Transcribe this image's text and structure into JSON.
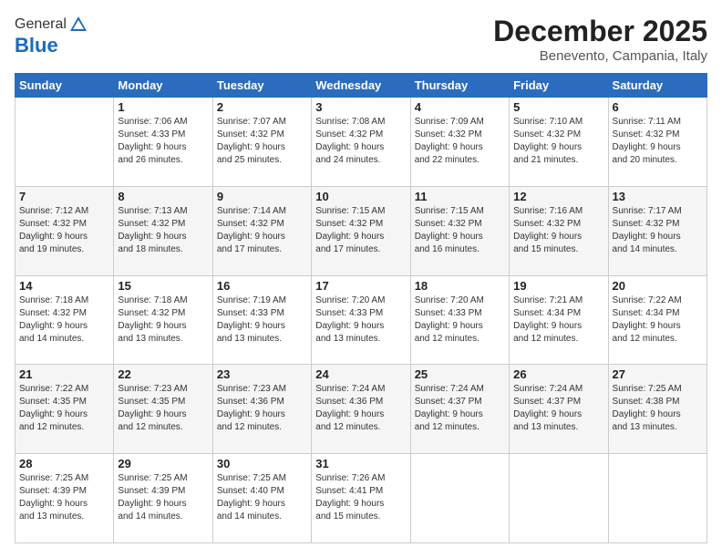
{
  "logo": {
    "general": "General",
    "blue": "Blue"
  },
  "header": {
    "month": "December 2025",
    "location": "Benevento, Campania, Italy"
  },
  "days_of_week": [
    "Sunday",
    "Monday",
    "Tuesday",
    "Wednesday",
    "Thursday",
    "Friday",
    "Saturday"
  ],
  "weeks": [
    [
      {
        "day": "",
        "info": ""
      },
      {
        "day": "1",
        "info": "Sunrise: 7:06 AM\nSunset: 4:33 PM\nDaylight: 9 hours\nand 26 minutes."
      },
      {
        "day": "2",
        "info": "Sunrise: 7:07 AM\nSunset: 4:32 PM\nDaylight: 9 hours\nand 25 minutes."
      },
      {
        "day": "3",
        "info": "Sunrise: 7:08 AM\nSunset: 4:32 PM\nDaylight: 9 hours\nand 24 minutes."
      },
      {
        "day": "4",
        "info": "Sunrise: 7:09 AM\nSunset: 4:32 PM\nDaylight: 9 hours\nand 22 minutes."
      },
      {
        "day": "5",
        "info": "Sunrise: 7:10 AM\nSunset: 4:32 PM\nDaylight: 9 hours\nand 21 minutes."
      },
      {
        "day": "6",
        "info": "Sunrise: 7:11 AM\nSunset: 4:32 PM\nDaylight: 9 hours\nand 20 minutes."
      }
    ],
    [
      {
        "day": "7",
        "info": "Sunrise: 7:12 AM\nSunset: 4:32 PM\nDaylight: 9 hours\nand 19 minutes."
      },
      {
        "day": "8",
        "info": "Sunrise: 7:13 AM\nSunset: 4:32 PM\nDaylight: 9 hours\nand 18 minutes."
      },
      {
        "day": "9",
        "info": "Sunrise: 7:14 AM\nSunset: 4:32 PM\nDaylight: 9 hours\nand 17 minutes."
      },
      {
        "day": "10",
        "info": "Sunrise: 7:15 AM\nSunset: 4:32 PM\nDaylight: 9 hours\nand 17 minutes."
      },
      {
        "day": "11",
        "info": "Sunrise: 7:15 AM\nSunset: 4:32 PM\nDaylight: 9 hours\nand 16 minutes."
      },
      {
        "day": "12",
        "info": "Sunrise: 7:16 AM\nSunset: 4:32 PM\nDaylight: 9 hours\nand 15 minutes."
      },
      {
        "day": "13",
        "info": "Sunrise: 7:17 AM\nSunset: 4:32 PM\nDaylight: 9 hours\nand 14 minutes."
      }
    ],
    [
      {
        "day": "14",
        "info": "Sunrise: 7:18 AM\nSunset: 4:32 PM\nDaylight: 9 hours\nand 14 minutes."
      },
      {
        "day": "15",
        "info": "Sunrise: 7:18 AM\nSunset: 4:32 PM\nDaylight: 9 hours\nand 13 minutes."
      },
      {
        "day": "16",
        "info": "Sunrise: 7:19 AM\nSunset: 4:33 PM\nDaylight: 9 hours\nand 13 minutes."
      },
      {
        "day": "17",
        "info": "Sunrise: 7:20 AM\nSunset: 4:33 PM\nDaylight: 9 hours\nand 13 minutes."
      },
      {
        "day": "18",
        "info": "Sunrise: 7:20 AM\nSunset: 4:33 PM\nDaylight: 9 hours\nand 12 minutes."
      },
      {
        "day": "19",
        "info": "Sunrise: 7:21 AM\nSunset: 4:34 PM\nDaylight: 9 hours\nand 12 minutes."
      },
      {
        "day": "20",
        "info": "Sunrise: 7:22 AM\nSunset: 4:34 PM\nDaylight: 9 hours\nand 12 minutes."
      }
    ],
    [
      {
        "day": "21",
        "info": "Sunrise: 7:22 AM\nSunset: 4:35 PM\nDaylight: 9 hours\nand 12 minutes."
      },
      {
        "day": "22",
        "info": "Sunrise: 7:23 AM\nSunset: 4:35 PM\nDaylight: 9 hours\nand 12 minutes."
      },
      {
        "day": "23",
        "info": "Sunrise: 7:23 AM\nSunset: 4:36 PM\nDaylight: 9 hours\nand 12 minutes."
      },
      {
        "day": "24",
        "info": "Sunrise: 7:24 AM\nSunset: 4:36 PM\nDaylight: 9 hours\nand 12 minutes."
      },
      {
        "day": "25",
        "info": "Sunrise: 7:24 AM\nSunset: 4:37 PM\nDaylight: 9 hours\nand 12 minutes."
      },
      {
        "day": "26",
        "info": "Sunrise: 7:24 AM\nSunset: 4:37 PM\nDaylight: 9 hours\nand 13 minutes."
      },
      {
        "day": "27",
        "info": "Sunrise: 7:25 AM\nSunset: 4:38 PM\nDaylight: 9 hours\nand 13 minutes."
      }
    ],
    [
      {
        "day": "28",
        "info": "Sunrise: 7:25 AM\nSunset: 4:39 PM\nDaylight: 9 hours\nand 13 minutes."
      },
      {
        "day": "29",
        "info": "Sunrise: 7:25 AM\nSunset: 4:39 PM\nDaylight: 9 hours\nand 14 minutes."
      },
      {
        "day": "30",
        "info": "Sunrise: 7:25 AM\nSunset: 4:40 PM\nDaylight: 9 hours\nand 14 minutes."
      },
      {
        "day": "31",
        "info": "Sunrise: 7:26 AM\nSunset: 4:41 PM\nDaylight: 9 hours\nand 15 minutes."
      },
      {
        "day": "",
        "info": ""
      },
      {
        "day": "",
        "info": ""
      },
      {
        "day": "",
        "info": ""
      }
    ]
  ]
}
